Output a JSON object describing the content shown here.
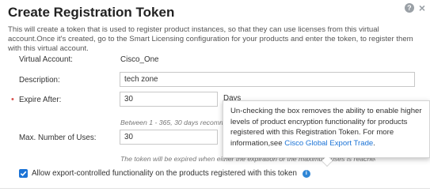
{
  "dialog": {
    "title": "Create Registration Token",
    "description": "This will create a token that is used to register product instances, so that they can use licenses from this virtual account.Once it's created, go to the Smart Licensing configuration for your products and enter the token, to register them with this virtual account."
  },
  "form": {
    "virtual_account": {
      "label": "Virtual Account:",
      "value": "Cisco_One"
    },
    "description": {
      "label": "Description:",
      "value": "tech zone"
    },
    "expire_after": {
      "label": "Expire After:",
      "value": "30",
      "unit": "Days",
      "hint": "Between 1 - 365, 30 days recomm"
    },
    "max_uses": {
      "label": "Max. Number of Uses:",
      "value": "30",
      "hint": "The token will be expired when either the expiration or the maximum uses is reached"
    },
    "export_controlled": {
      "label": "Allow export-controlled functionality on the products registered with this token",
      "checked": true
    }
  },
  "tooltip": {
    "text": "Un-checking the box removes the ability to enable higher levels of product encryption functionality for products registered with this Registration Token. For more information,see ",
    "link": "Cisco Global Export Trade",
    "end": "."
  },
  "icons": {
    "help": "help-icon",
    "close": "close-icon",
    "info": "info-icon",
    "check": "check-icon"
  },
  "colors": {
    "accent": "#1b73d6",
    "required": "#d9534f"
  }
}
